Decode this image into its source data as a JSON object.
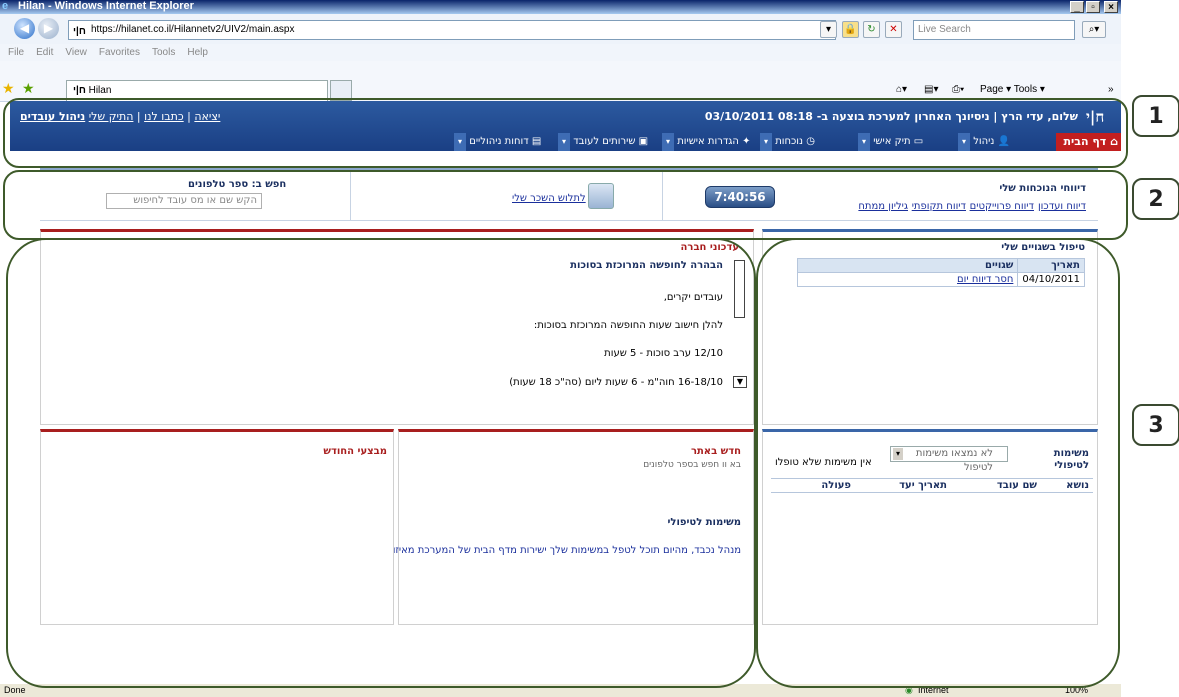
{
  "browser": {
    "title": "Hilan - Windows Internet Explorer",
    "address": "https://hilanet.co.il/Hilannetv2/UIV2/main.aspx",
    "search_placeholder": "Live Search",
    "menu": [
      "File",
      "Edit",
      "View",
      "Favorites",
      "Tools",
      "Help"
    ],
    "tab_label": "Hilan",
    "right_tools": "Page ▾  Tools ▾",
    "status_left": "Done",
    "status_zone": "Internet",
    "zoom": "100%"
  },
  "header": {
    "greeting": "שלום, עדי הרץ | ניסיונך האחרון למערכת בוצעה ב- 08:18 03/10/2011",
    "links": [
      "ניהול עובדים",
      "התיק שלי",
      "כתבו לנו",
      "יציאה"
    ],
    "logo": "ח|י",
    "home": "דף הבית",
    "menu": [
      "ניהול",
      "תיק אישי",
      "נוכחות",
      "הגדרות אישיות",
      "שירותים לעובד",
      "דוחות ניהוליים"
    ]
  },
  "tools": {
    "reports_title": "דיווחי הנוכחות שלי",
    "reports_links": [
      "דיווח ועדכון",
      "דיווח פרוייקטים",
      "דיווח תקופתי",
      "גיליון ממתח"
    ],
    "clock": "7:40:56",
    "payslip_link": "לתלוש השכר שלי",
    "phone_title": "חפש ב: ספר טלפונים",
    "phone_placeholder": "הקש שם או מס עובד לחיפוש"
  },
  "errors": {
    "title": "טיפול בשגויים שלי",
    "columns": [
      "תאריך",
      "שגויים"
    ],
    "rows": [
      {
        "date": "04/10/2011",
        "error": "חסר דיווח יום"
      }
    ]
  },
  "company_updates": {
    "title": "עדכוני חברה",
    "headline": "הבהרה לחופשה המרוכזת בסוכות",
    "lines": [
      "עובדים יקרים,",
      "להלן חישוב שעות החופשה המרוכזת בסוכות:",
      "12/10 ערב סוכות - 5 שעות",
      "16-18/10 חוה\"מ - 6 שעות ליום (סה\"כ 18 שעות)"
    ]
  },
  "tasks": {
    "title": "משימות לטיפולי",
    "select_value": "לא נמצאו משימות לטיפול",
    "none_text": "אין משימות שלא טופלו",
    "columns": [
      "נושא",
      "שם עובד",
      "תאריך יעד",
      "פעולה"
    ]
  },
  "whats_new": {
    "title": "חדש באתר",
    "cut_line": "בא וו  חפש בספר טלפונים",
    "section": "משימות לטיפולי",
    "body": "מנהל נכבד, מהיום תוכל לטפל במשימות שלך ישירות מדף הבית של המערכת  מאיזור"
  },
  "month_excellent": {
    "title": "מבצעי החודש"
  },
  "annotations": [
    "1",
    "2",
    "3"
  ]
}
